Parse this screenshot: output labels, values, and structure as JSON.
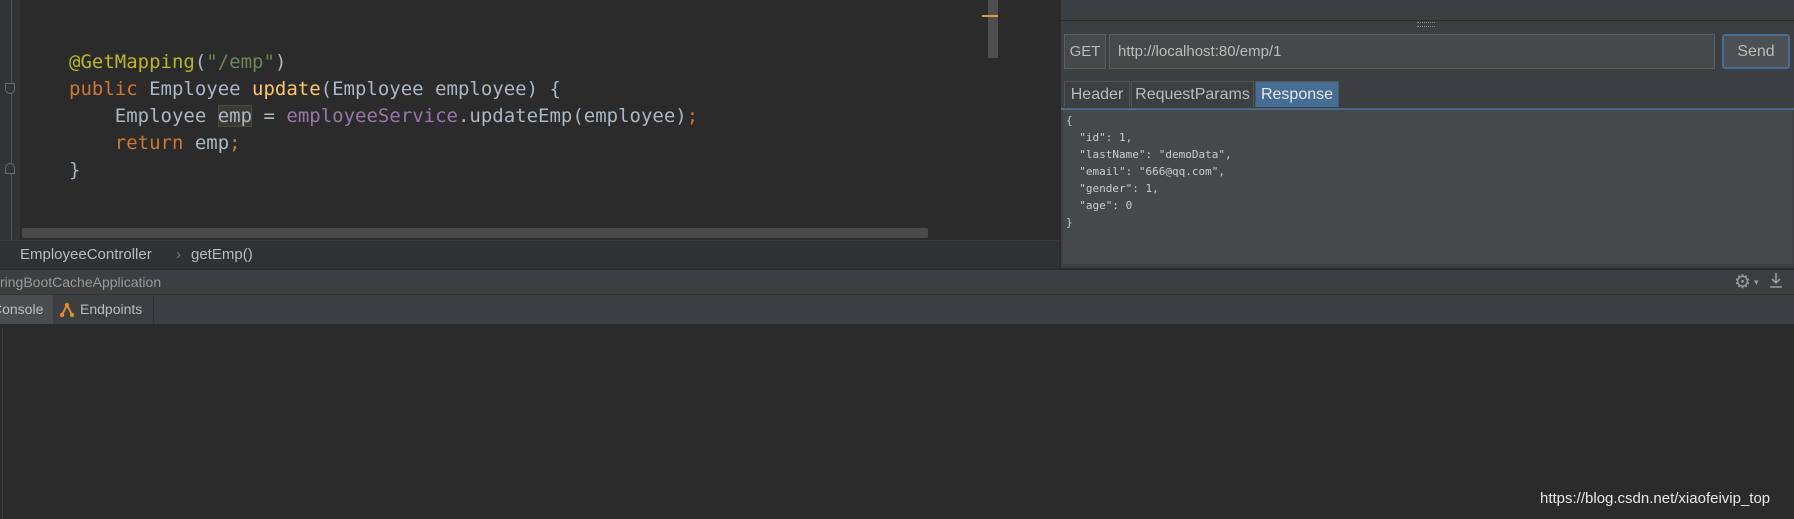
{
  "editor": {
    "lines": [
      [
        {
          "t": "@GetMapping",
          "c": "ann"
        },
        {
          "t": "(",
          "c": "plain"
        },
        {
          "t": "\"/emp\"",
          "c": "str"
        },
        {
          "t": ")",
          "c": "plain"
        }
      ],
      [
        {
          "t": "public ",
          "c": "kw"
        },
        {
          "t": "Employee ",
          "c": "plain"
        },
        {
          "t": "update",
          "c": "fn"
        },
        {
          "t": "(Employee employee) {",
          "c": "plain"
        }
      ],
      [
        {
          "t": "    Employee ",
          "c": "plain"
        },
        {
          "t": "emp",
          "c": "hl"
        },
        {
          "t": " = ",
          "c": "plain"
        },
        {
          "t": "employeeService",
          "c": "field"
        },
        {
          "t": ".updateEmp(employee)",
          "c": "plain"
        },
        {
          "t": ";",
          "c": "kw"
        }
      ],
      [
        {
          "t": "    return ",
          "c": "kw"
        },
        {
          "t": "emp",
          "c": "plain"
        },
        {
          "t": ";",
          "c": "kw"
        }
      ],
      [
        {
          "t": "}",
          "c": "plain"
        }
      ]
    ]
  },
  "breadcrumb": {
    "class_name": "EmployeeController",
    "separator": "›",
    "method_name": "getEmp()"
  },
  "rest_client": {
    "method": "GET",
    "url": "http://localhost:80/emp/1",
    "send_label": "Send",
    "tabs": [
      "Header",
      "RequestParams",
      "Response"
    ],
    "active_tab": "Response",
    "response_body": "{\n  \"id\": 1,\n  \"lastName\": \"demoData\",\n  \"email\": \"666@qq.com\",\n  \"gender\": 1,\n  \"age\": 0\n}"
  },
  "run_panel": {
    "title": "ringBootCacheApplication",
    "tabs": {
      "console": "Console",
      "endpoints": "Endpoints"
    }
  },
  "watermark": "https://blog.csdn.net/xiaofeivip_top",
  "colors": {
    "background": "#2b2b2b",
    "keyword": "#cc7832",
    "annotation": "#bbb529",
    "string": "#6a8759",
    "function": "#ffc66d",
    "field": "#9876aa",
    "active_tab": "#466d94"
  },
  "icons": {
    "settings": "gear-icon",
    "download": "download-icon",
    "endpoints": "endpoints-icon"
  }
}
